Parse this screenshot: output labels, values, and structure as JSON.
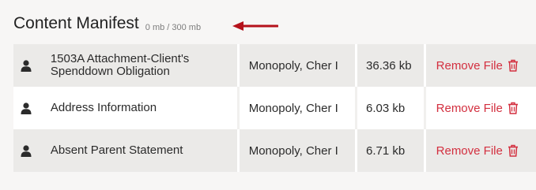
{
  "header": {
    "title": "Content Manifest",
    "quota": "0 mb / 300 mb"
  },
  "colors": {
    "accent_red": "#d32f3f",
    "arrow_red": "#b5121b",
    "row_shade": "#ebeae8"
  },
  "files": [
    {
      "name": "1503A Attachment-Client's Spenddown Obligation",
      "owner": "Monopoly, Cher I",
      "size": "36.36 kb",
      "action": "Remove File",
      "icon": "person-icon",
      "action_icon": "trash-icon"
    },
    {
      "name": "Address Information",
      "owner": "Monopoly, Cher I",
      "size": "6.03 kb",
      "action": "Remove File",
      "icon": "person-icon",
      "action_icon": "trash-icon"
    },
    {
      "name": "Absent Parent Statement",
      "owner": "Monopoly, Cher I",
      "size": "6.71 kb",
      "action": "Remove File",
      "icon": "person-icon",
      "action_icon": "trash-icon"
    }
  ]
}
